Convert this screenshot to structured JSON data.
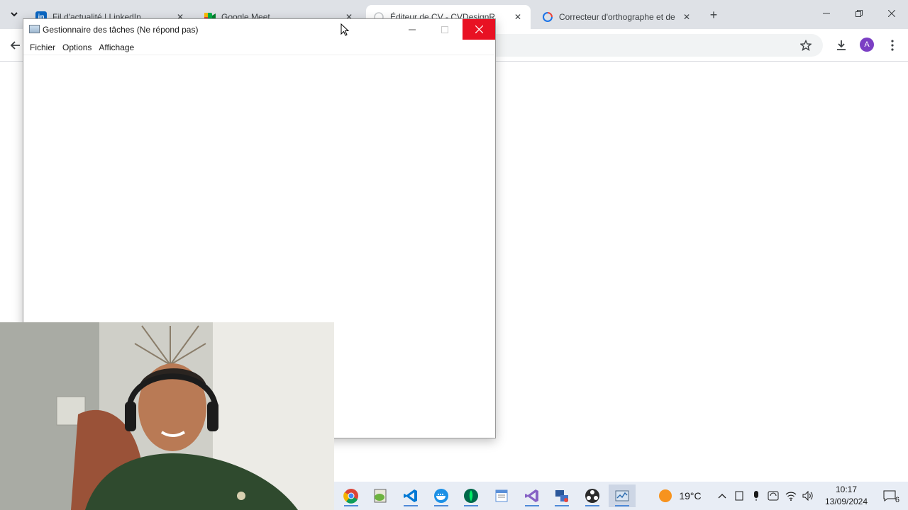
{
  "browser": {
    "tabs": [
      {
        "title": "Fil d'actualité | LinkedIn",
        "favicon": "linkedin-icon",
        "active": false
      },
      {
        "title": "Google Meet",
        "favicon": "google-meet-icon",
        "active": false
      },
      {
        "title": "Éditeur de CV - CVDesignR",
        "favicon": "loading-spinner-icon",
        "active": true
      },
      {
        "title": "Correcteur d'orthographe et de",
        "favicon": "reverso-icon",
        "active": false
      }
    ],
    "new_tab_label": "+",
    "avatar_letter": "A",
    "accent_colors": {
      "linkedin": "#0a66c2",
      "meet": "#00832d",
      "close_red": "#e81123",
      "avatar": "#7b3fc4"
    }
  },
  "task_manager": {
    "title": "Gestionnaire des tâches (Ne répond pas)",
    "menu": [
      "Fichier",
      "Options",
      "Affichage"
    ]
  },
  "taskbar": {
    "apps": [
      "chrome-icon",
      "notepad-plus-plus-icon",
      "vscode-icon",
      "docker-icon",
      "mongodb-compass-icon",
      "text-editor-icon",
      "visual-studio-icon",
      "network-tool-icon",
      "obs-icon",
      "task-manager-icon"
    ],
    "weather": {
      "temperature": "19°C",
      "icon": "sun-icon"
    },
    "clock": {
      "time": "10:17",
      "date": "13/09/2024"
    },
    "notification_count": "6"
  }
}
